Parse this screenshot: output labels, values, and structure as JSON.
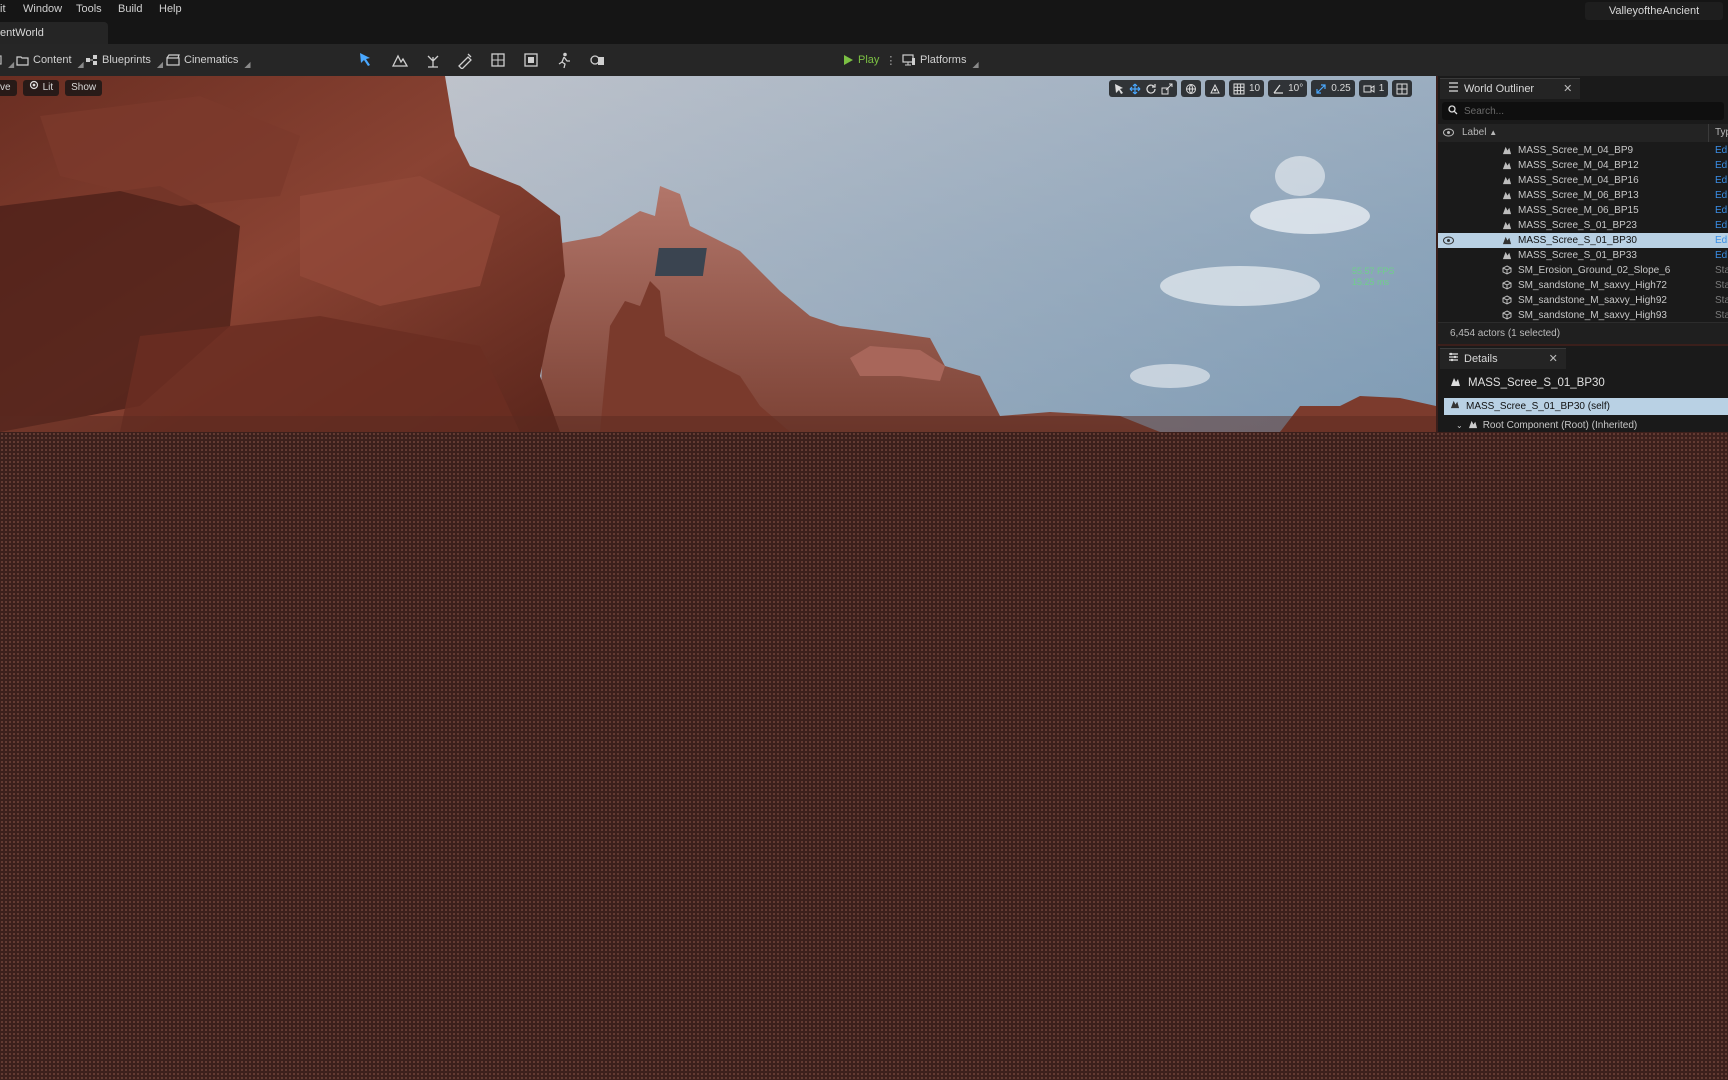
{
  "menu": {
    "items": [
      "it",
      "Window",
      "Tools",
      "Build",
      "Help"
    ],
    "project_name": "ValleyoftheAncient"
  },
  "level_tab": {
    "label": "entWorld"
  },
  "toolbar": {
    "save_icon": "save-icon",
    "content_label": "Content",
    "blueprints_label": "Blueprints",
    "cinematics_label": "Cinematics",
    "mode_icons": [
      "select-mode-icon",
      "landscape-mode-icon",
      "foliage-mode-icon",
      "mesh-paint-mode-icon",
      "fracture-mode-icon",
      "brush-edit-mode-icon",
      "animation-mode-icon",
      "modeling-mode-icon"
    ],
    "play_label": "Play",
    "platforms_label": "Platforms",
    "accent_color": "#7bc043"
  },
  "viewport": {
    "perspective_label": "ve",
    "lit_label": "Lit",
    "show_label": "Show",
    "grid_snap": "10",
    "rotation_snap": "10°",
    "scale_snap": "0.25",
    "camera_speed": "1",
    "fps": "55.57 FPS",
    "frame_ms": "15.25 ms"
  },
  "outliner": {
    "title": "World Outliner",
    "search_placeholder": "Search...",
    "label_header": "Label",
    "type_header": "Typ",
    "rows": [
      {
        "label": "MASS_Scree_M_04_BP9",
        "type": "Ed",
        "icon": "blueprint-actor-icon"
      },
      {
        "label": "MASS_Scree_M_04_BP12",
        "type": "Ed",
        "icon": "blueprint-actor-icon"
      },
      {
        "label": "MASS_Scree_M_04_BP16",
        "type": "Ed",
        "icon": "blueprint-actor-icon"
      },
      {
        "label": "MASS_Scree_M_06_BP13",
        "type": "Ed",
        "icon": "blueprint-actor-icon"
      },
      {
        "label": "MASS_Scree_M_06_BP15",
        "type": "Ed",
        "icon": "blueprint-actor-icon"
      },
      {
        "label": "MASS_Scree_S_01_BP23",
        "type": "Ed",
        "icon": "blueprint-actor-icon"
      },
      {
        "label": "MASS_Scree_S_01_BP30",
        "type": "Ed",
        "icon": "blueprint-actor-icon",
        "selected": true
      },
      {
        "label": "MASS_Scree_S_01_BP33",
        "type": "Ed",
        "icon": "blueprint-actor-icon"
      },
      {
        "label": "SM_Erosion_Ground_02_Slope_6",
        "type": "Sta",
        "icon": "static-mesh-icon"
      },
      {
        "label": "SM_sandstone_M_saxvy_High72",
        "type": "Sta",
        "icon": "static-mesh-icon"
      },
      {
        "label": "SM_sandstone_M_saxvy_High92",
        "type": "Sta",
        "icon": "static-mesh-icon"
      },
      {
        "label": "SM_sandstone_M_saxvy_High93",
        "type": "Sta",
        "icon": "static-mesh-icon"
      }
    ],
    "footer": "6,454 actors (1 selected)"
  },
  "details": {
    "title": "Details",
    "actor_name": "MASS_Scree_S_01_BP30",
    "self_row": "MASS_Scree_S_01_BP30 (self)",
    "root_component": "Root Component (Root) (Inherited)",
    "selection_color": "#b9d1e4"
  }
}
